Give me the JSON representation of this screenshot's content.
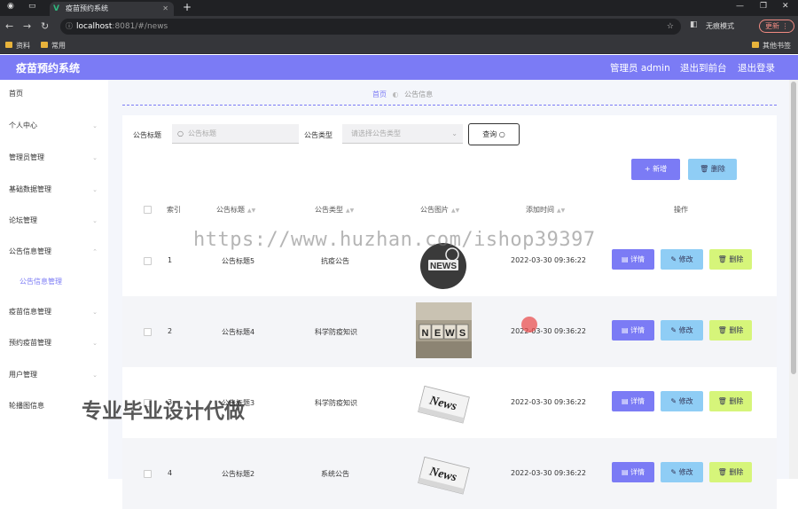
{
  "browser": {
    "tab_title": "疫苗预约系统",
    "url_host": "localhost",
    "url_path": ":8081/#/news",
    "incognito_label": "无痕模式",
    "update_label": "更新",
    "bookmarks": [
      "资料",
      "常用"
    ],
    "other_bookmarks": "其他书签"
  },
  "header": {
    "app_name": "疫苗预约系统",
    "user": "管理员 admin",
    "to_front": "退出到前台",
    "logout": "退出登录",
    "brand_color": "#7b7bf5"
  },
  "sidebar": {
    "items": [
      {
        "label": "首页"
      },
      {
        "label": "个人中心"
      },
      {
        "label": "管理员管理"
      },
      {
        "label": "基础数据管理"
      },
      {
        "label": "论坛管理"
      },
      {
        "label": "公告信息管理"
      },
      {
        "label": "公告信息管理"
      },
      {
        "label": "疫苗信息管理"
      },
      {
        "label": "预约疫苗管理"
      },
      {
        "label": "用户管理"
      },
      {
        "label": "轮播图信息"
      }
    ]
  },
  "breadcrumb": {
    "home": "首页",
    "current": "公告信息"
  },
  "search": {
    "title_label": "公告标题",
    "title_placeholder": "公告标题",
    "type_label": "公告类型",
    "type_placeholder": "请选择公告类型",
    "query_label": "查询"
  },
  "actions": {
    "add_label": "新增",
    "delete_label": "删除"
  },
  "table": {
    "headers": [
      "索引",
      "公告标题",
      "公告类型",
      "公告图片",
      "添加时间",
      "操作"
    ],
    "rows": [
      {
        "index": "1",
        "title": "公告标题5",
        "type": "抗疫公告",
        "time": "2022-03-30 09:36:22",
        "image": "news-globe-icon"
      },
      {
        "index": "2",
        "title": "公告标题4",
        "type": "科学防疫知识",
        "time": "2022-03-30 09:36:22",
        "image": "news-blocks-photo"
      },
      {
        "index": "3",
        "title": "公告标题3",
        "type": "科学防疫知识",
        "time": "2022-03-30 09:36:22",
        "image": "newspaper-photo"
      },
      {
        "index": "4",
        "title": "公告标题2",
        "type": "系统公告",
        "time": "2022-03-30 09:36:22",
        "image": "newspaper-photo"
      }
    ],
    "row_actions": {
      "detail": "详情",
      "edit": "修改",
      "remove": "删除"
    }
  },
  "watermarks": {
    "url": "https://www.huzhan.com/ishop39397",
    "text": "专业毕业设计代做"
  }
}
